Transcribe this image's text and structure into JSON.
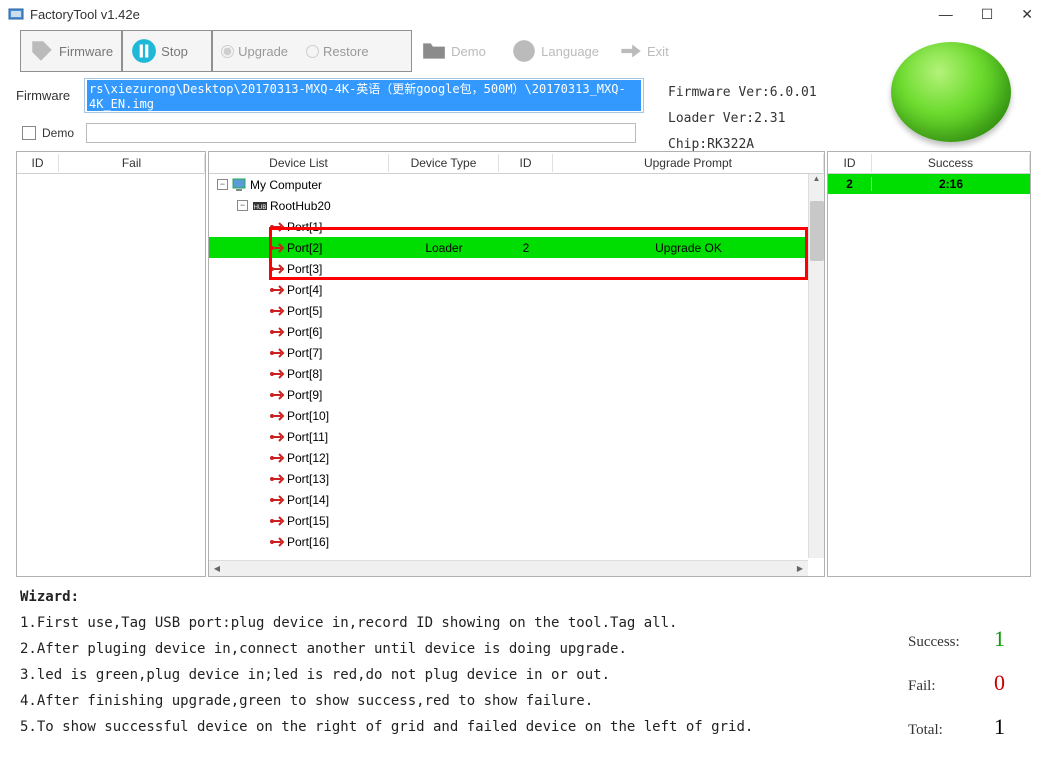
{
  "window": {
    "title": "FactoryTool v1.42e"
  },
  "toolbar": {
    "firmware": "Firmware",
    "stop": "Stop",
    "upgrade": "Upgrade",
    "restore": "Restore",
    "demo": "Demo",
    "language": "Language",
    "exit": "Exit"
  },
  "firmware_row": {
    "label": "Firmware",
    "path": "rs\\xiezurong\\Desktop\\20170313-MXQ-4K-英语（更新google包，500M）\\20170313_MXQ-4K_EN.img"
  },
  "info": {
    "fw_ver_label": "Firmware Ver:",
    "fw_ver": "6.0.01",
    "loader_ver_label": "Loader Ver:",
    "loader_ver": "2.31",
    "chip_label": "Chip:",
    "chip": "RK322A"
  },
  "demo_row": {
    "label": "Demo"
  },
  "left_panel": {
    "headers": [
      "ID",
      "Fail"
    ]
  },
  "center_panel": {
    "headers": [
      "Device List",
      "Device Type",
      "ID",
      "Upgrade Prompt"
    ],
    "root": "My Computer",
    "hub": "RootHub20",
    "ports": [
      "Port[1]",
      "Port[2]",
      "Port[3]",
      "Port[4]",
      "Port[5]",
      "Port[6]",
      "Port[7]",
      "Port[8]",
      "Port[9]",
      "Port[10]",
      "Port[11]",
      "Port[12]",
      "Port[13]",
      "Port[14]",
      "Port[15]",
      "Port[16]"
    ],
    "highlighted": {
      "index": 1,
      "device_type": "Loader",
      "id": "2",
      "prompt": "Upgrade OK"
    }
  },
  "right_panel": {
    "headers": [
      "ID",
      "Success"
    ],
    "rows": [
      {
        "id": "2",
        "val": "2:16"
      }
    ]
  },
  "wizard": {
    "header": "Wizard:",
    "lines": [
      "1.First use,Tag USB port:plug device in,record ID showing on the tool.Tag all.",
      "2.After pluging device in,connect another until device is doing upgrade.",
      "3.led is green,plug device in;led is red,do not plug device in or out.",
      "4.After finishing upgrade,green to show success,red to show failure.",
      "5.To show successful device on the right of grid and failed device on the left of grid."
    ]
  },
  "stats": {
    "success_label": "Success:",
    "success": "1",
    "fail_label": "Fail:",
    "fail": "0",
    "total_label": "Total:",
    "total": "1"
  }
}
